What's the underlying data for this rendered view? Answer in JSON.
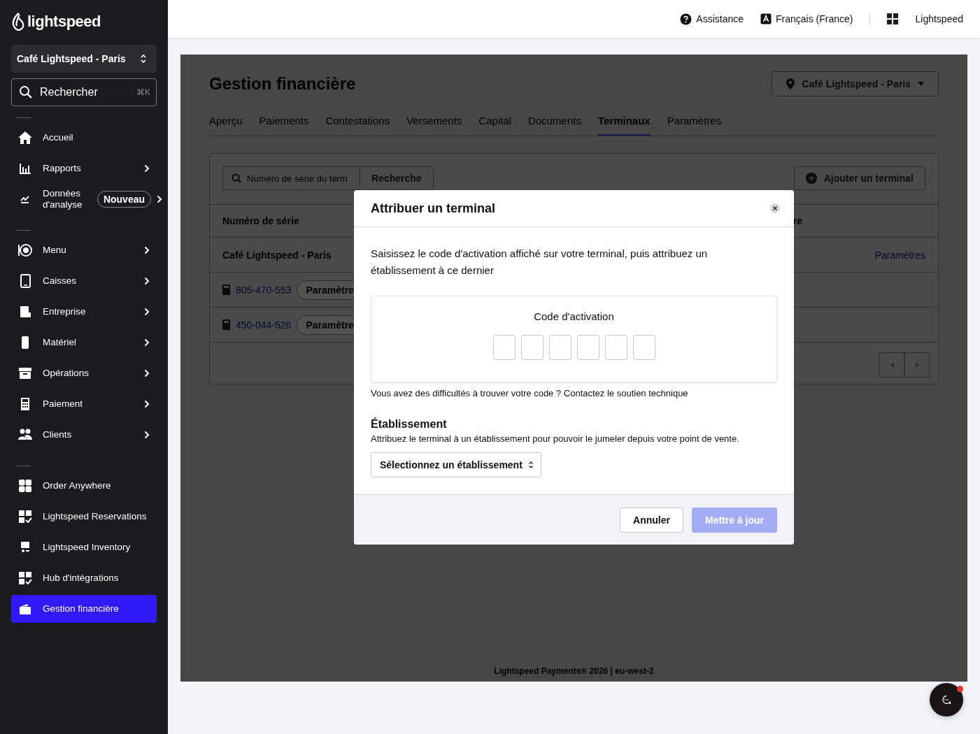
{
  "sidebar": {
    "logo": "lightspeed",
    "location": "Café Lightspeed - Paris",
    "search": {
      "placeholder": "Rechercher",
      "shortcut": "⌘K"
    },
    "groups": [
      [
        {
          "label": "Accueil",
          "arrow": false,
          "selected": false
        },
        {
          "label": "Rapports",
          "arrow": true,
          "selected": false
        },
        {
          "label": "Données d'analyse",
          "arrow": true,
          "badge": "Nouveau",
          "selected": false
        }
      ],
      [
        {
          "label": "Menu",
          "arrow": true,
          "selected": false
        },
        {
          "label": "Caisses",
          "arrow": true,
          "selected": false
        },
        {
          "label": "Entreprise",
          "arrow": true,
          "selected": false
        },
        {
          "label": "Matériel",
          "arrow": true,
          "selected": false
        },
        {
          "label": "Opérations",
          "arrow": true,
          "selected": false
        },
        {
          "label": "Paiement",
          "arrow": true,
          "selected": false
        },
        {
          "label": "Clients",
          "arrow": true,
          "selected": false
        }
      ],
      [
        {
          "label": "Order Anywhere",
          "arrow": false,
          "selected": false
        },
        {
          "label": "Lightspeed Reservations",
          "arrow": false,
          "selected": false
        },
        {
          "label": "Lightspeed Inventory",
          "arrow": false,
          "selected": false
        },
        {
          "label": "Hub d'intégrations",
          "arrow": false,
          "selected": false
        },
        {
          "label": "Gestion financière",
          "arrow": false,
          "selected": true
        }
      ]
    ]
  },
  "header": {
    "help": "Assistance",
    "language": "Français (France)",
    "account": "Lightspeed"
  },
  "page": {
    "title": "Gestion financière",
    "location": "Café Lightspeed - Paris",
    "tabs": [
      {
        "label": "Aperçu",
        "selected": false
      },
      {
        "label": "Paiements",
        "selected": false
      },
      {
        "label": "Contestations",
        "selected": false
      },
      {
        "label": "Versements",
        "selected": false
      },
      {
        "label": "Capital",
        "selected": false
      },
      {
        "label": "Documents",
        "selected": false
      },
      {
        "label": "Terminaux",
        "selected": true
      },
      {
        "label": "Paramètres",
        "selected": false
      }
    ],
    "search_placeholder": "Numéro de série du term",
    "search_button": "Recherche",
    "add_button": "Ajouter un terminal",
    "table": {
      "columns": [
        "Numéro de série",
        "re"
      ],
      "group": {
        "name": "Café Lightspeed - Paris",
        "action": "Paramètres"
      },
      "rows": [
        {
          "serial": "805-470-553",
          "chip": "Paramètre"
        },
        {
          "serial": "450-044-526",
          "chip": "Paramètre"
        }
      ]
    },
    "footer": "Lightspeed Payments® 2026 | eu-west-2"
  },
  "modal": {
    "title": "Attribuer un terminal",
    "description": "Saisissez le code d'activation affiché sur votre terminal, puis attribuez un établissement à ce dernier",
    "code_label": "Code d'activation",
    "code_inputs": [
      {
        "filled": false
      },
      {
        "filled": false
      },
      {
        "filled": false
      },
      {
        "filled": false
      },
      {
        "filled": false
      },
      {
        "filled": false
      }
    ],
    "help": "Vous avez des difficultés à trouver votre code ? Contactez le soutien technique",
    "section_title": "Établissement",
    "section_hint": "Attribuez le terminal à un établissement pour pouvoir le jumeler depuis votre point de vente.",
    "select_placeholder": "Sélectionnez un établissement",
    "cancel": "Annuler",
    "submit": {
      "label": "Mettre à jour",
      "disabled": true
    }
  },
  "chat": {
    "has_notification": true
  }
}
